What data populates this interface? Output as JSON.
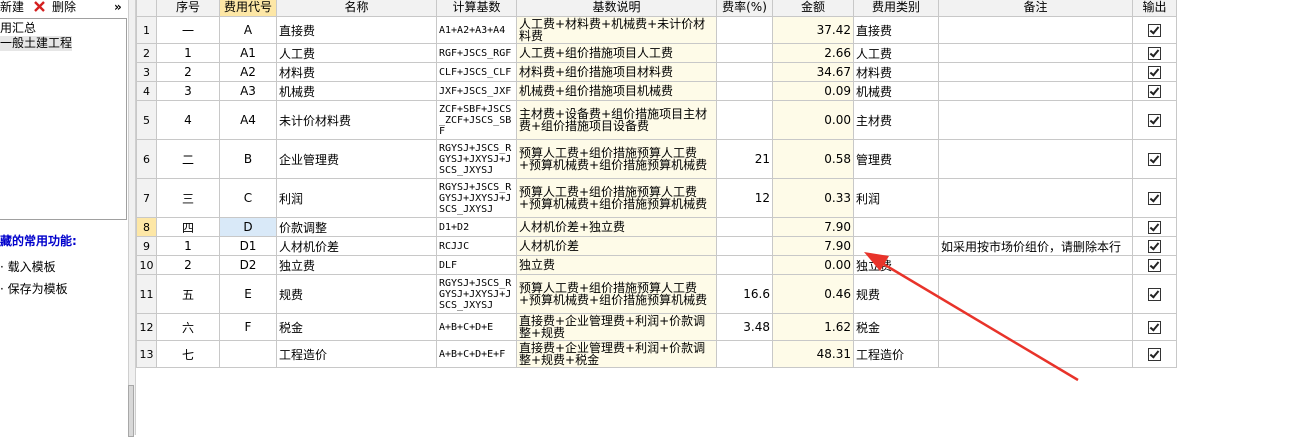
{
  "toolbar": {
    "new_label": "新建",
    "delete_label": "删除",
    "more_label": "»"
  },
  "tree": {
    "items": [
      {
        "label": "用汇总"
      },
      {
        "label": "一般土建工程"
      }
    ]
  },
  "favorites": {
    "title": "藏的常用功能:",
    "load_label": "载入模板",
    "save_label": "保存为模板"
  },
  "grid": {
    "headers": [
      "",
      "序号",
      "费用代号",
      "名称",
      "计算基数",
      "基数说明",
      "费率(%)",
      "金额",
      "费用类别",
      "备注",
      "输出"
    ],
    "rows": [
      {
        "rn": "1",
        "seq": "一",
        "code": "A",
        "name": "直接费",
        "base": "A1+A2+A3+A4",
        "desc": "人工费+材料费+机械费+未计价材料费",
        "rate": "",
        "amount": "37.42",
        "category": "直接费",
        "note": "",
        "output": "checked"
      },
      {
        "rn": "2",
        "seq": "1",
        "code": "A1",
        "name": "人工费",
        "base": "RGF+JSCS_RGF",
        "desc": "人工费+组价措施项目人工费",
        "rate": "",
        "amount": "2.66",
        "category": "人工费",
        "note": "",
        "output": "checked"
      },
      {
        "rn": "3",
        "seq": "2",
        "code": "A2",
        "name": "材料费",
        "base": "CLF+JSCS_CLF",
        "desc": "材料费+组价措施项目材料费",
        "rate": "",
        "amount": "34.67",
        "category": "材料费",
        "note": "",
        "output": "checked"
      },
      {
        "rn": "4",
        "seq": "3",
        "code": "A3",
        "name": "机械费",
        "base": "JXF+JSCS_JXF",
        "desc": "机械费+组价措施项目机械费",
        "rate": "",
        "amount": "0.09",
        "category": "机械费",
        "note": "",
        "output": "checked"
      },
      {
        "rn": "5",
        "seq": "4",
        "code": "A4",
        "name": "未计价材料费",
        "base": "ZCF+SBF+JSCS_ZCF+JSCS_SBF",
        "desc": "主材费+设备费+组价措施项目主材费+组价措施项目设备费",
        "rate": "",
        "amount": "0.00",
        "category": "主材费",
        "note": "",
        "output": "checked"
      },
      {
        "rn": "6",
        "seq": "二",
        "code": "B",
        "name": "企业管理费",
        "base": "RGYSJ+JSCS_RGYSJ+JXYSJ+JSCS_JXYSJ",
        "desc": "预算人工费+组价措施预算人工费+预算机械费+组价措施预算机械费",
        "rate": "21",
        "amount": "0.58",
        "category": "管理费",
        "note": "",
        "output": "checked"
      },
      {
        "rn": "7",
        "seq": "三",
        "code": "C",
        "name": "利润",
        "base": "RGYSJ+JSCS_RGYSJ+JXYSJ+JSCS_JXYSJ",
        "desc": "预算人工费+组价措施预算人工费+预算机械费+组价措施预算机械费",
        "rate": "12",
        "amount": "0.33",
        "category": "利润",
        "note": "",
        "output": "checked"
      },
      {
        "rn": "8",
        "seq": "四",
        "code": "D",
        "name": "价款调整",
        "base": "D1+D2",
        "desc": "人材机价差+独立费",
        "rate": "",
        "amount": "7.90",
        "category": "",
        "note": "",
        "output": "checked"
      },
      {
        "rn": "9",
        "seq": "1",
        "code": "D1",
        "name": "人材机价差",
        "base": "RCJJC",
        "desc": "人材机价差",
        "rate": "",
        "amount": "7.90",
        "category": "",
        "note": "如采用按市场价组价，请删除本行",
        "output": "checked"
      },
      {
        "rn": "10",
        "seq": "2",
        "code": "D2",
        "name": "独立费",
        "base": "DLF",
        "desc": "独立费",
        "rate": "",
        "amount": "0.00",
        "category": "独立费",
        "note": "",
        "output": "checked"
      },
      {
        "rn": "11",
        "seq": "五",
        "code": "E",
        "name": "规费",
        "base": "RGYSJ+JSCS_RGYSJ+JXYSJ+JSCS_JXYSJ",
        "desc": "预算人工费+组价措施预算人工费+预算机械费+组价措施预算机械费",
        "rate": "16.6",
        "amount": "0.46",
        "category": "规费",
        "note": "",
        "output": "checked"
      },
      {
        "rn": "12",
        "seq": "六",
        "code": "F",
        "name": "税金",
        "base": "A+B+C+D+E",
        "desc": "直接费+企业管理费+利润+价款调整+规费",
        "rate": "3.48",
        "amount": "1.62",
        "category": "税金",
        "note": "",
        "output": "checked"
      },
      {
        "rn": "13",
        "seq": "七",
        "code": "",
        "name": "工程造价",
        "base": "A+B+C+D+E+F",
        "desc": "直接费+企业管理费+利润+价款调整+规费+税金",
        "rate": "",
        "amount": "48.31",
        "category": "工程造价",
        "note": "",
        "output": "checked"
      }
    ]
  },
  "colors": {
    "header_bg": "#f2f2f2",
    "selected_header": "#fde7a6",
    "arrow": "#e8332a",
    "favorites_title": "#0000cc"
  }
}
